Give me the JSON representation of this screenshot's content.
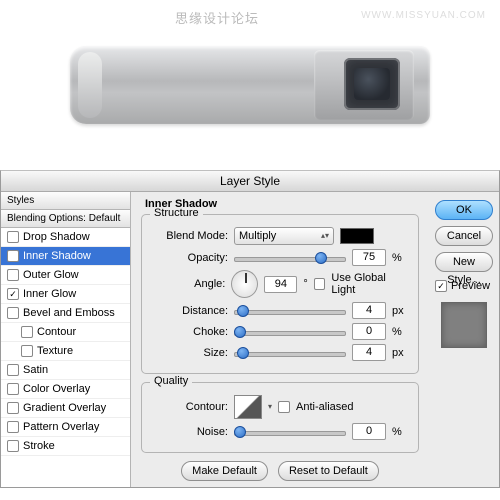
{
  "watermark": {
    "cn": "思缘设计论坛",
    "url": "WWW.MISSYUAN.COM"
  },
  "dialog": {
    "title": "Layer Style"
  },
  "sidebar": {
    "header1": "Styles",
    "header2": "Blending Options: Default",
    "items": [
      {
        "label": "Drop Shadow",
        "checked": false
      },
      {
        "label": "Inner Shadow",
        "checked": true,
        "selected": true
      },
      {
        "label": "Outer Glow",
        "checked": false
      },
      {
        "label": "Inner Glow",
        "checked": true
      },
      {
        "label": "Bevel and Emboss",
        "checked": false
      },
      {
        "label": "Contour",
        "checked": false,
        "sub": true
      },
      {
        "label": "Texture",
        "checked": false,
        "sub": true
      },
      {
        "label": "Satin",
        "checked": false
      },
      {
        "label": "Color Overlay",
        "checked": false
      },
      {
        "label": "Gradient Overlay",
        "checked": false
      },
      {
        "label": "Pattern Overlay",
        "checked": false
      },
      {
        "label": "Stroke",
        "checked": false
      }
    ]
  },
  "panel": {
    "title": "Inner Shadow",
    "structure": {
      "title": "Structure",
      "blendmode_label": "Blend Mode:",
      "blendmode_value": "Multiply",
      "opacity_label": "Opacity:",
      "opacity_value": "75",
      "opacity_unit": "%",
      "angle_label": "Angle:",
      "angle_value": "94",
      "angle_deg": "°",
      "global_label": "Use Global Light",
      "distance_label": "Distance:",
      "distance_value": "4",
      "px": "px",
      "choke_label": "Choke:",
      "choke_value": "0",
      "choke_unit": "%",
      "size_label": "Size:",
      "size_value": "4"
    },
    "quality": {
      "title": "Quality",
      "contour_label": "Contour:",
      "aa_label": "Anti-aliased",
      "noise_label": "Noise:",
      "noise_value": "0",
      "noise_unit": "%"
    },
    "buttons": {
      "makedef": "Make Default",
      "reset": "Reset to Default"
    }
  },
  "right": {
    "ok": "OK",
    "cancel": "Cancel",
    "newstyle": "New Style...",
    "preview": "Preview"
  }
}
